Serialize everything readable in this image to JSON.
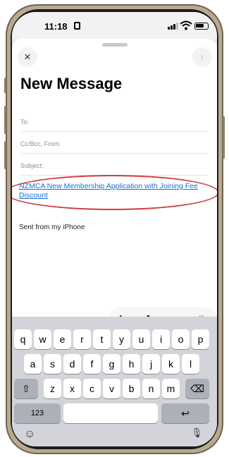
{
  "status_bar": {
    "time": "11:18"
  },
  "compose": {
    "title": "New Message",
    "to_label": "To:",
    "cc_label": "Cc/Bcc, From:",
    "subject_label": "Subject:",
    "body_link": "NZMCA New Membership Application with Joining Fee Discount",
    "signature": "Sent from my iPhone",
    "close_icon": "×",
    "send_icon": "↑"
  },
  "format_bar": {
    "text_format": "Aa",
    "photo_icon": "✿",
    "attach_icon": "⌀",
    "markup_icon": "Ⓐ"
  },
  "keyboard": {
    "row1": [
      "q",
      "w",
      "e",
      "r",
      "t",
      "y",
      "u",
      "i",
      "o",
      "p"
    ],
    "row2": [
      "a",
      "s",
      "d",
      "f",
      "g",
      "h",
      "j",
      "k",
      "l"
    ],
    "row3": [
      "z",
      "x",
      "c",
      "v",
      "b",
      "n",
      "m"
    ],
    "shift": "⇧",
    "delete": "⌫",
    "numbers": "123",
    "return": "↩",
    "emoji": "☺",
    "mic": "🎙"
  }
}
